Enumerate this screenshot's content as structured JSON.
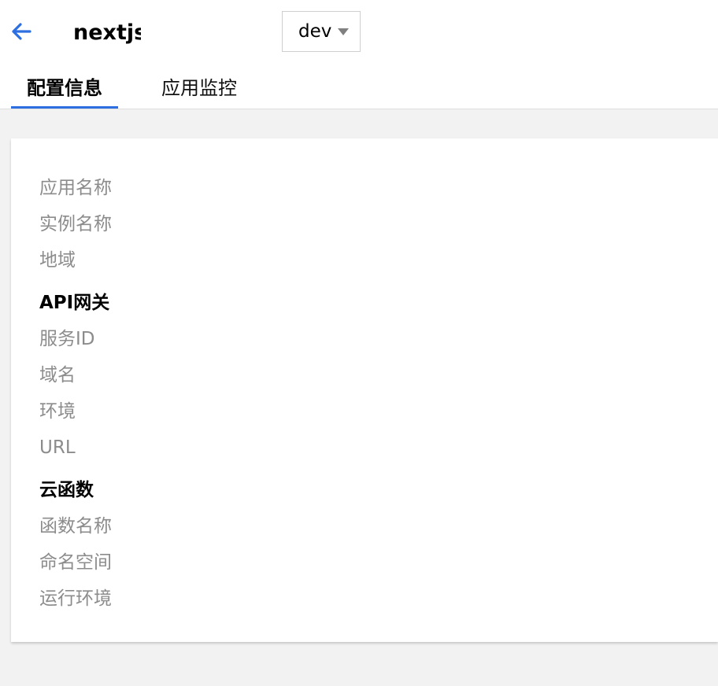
{
  "header": {
    "back_icon": "arrow-left-icon",
    "app_name": "nextjs-",
    "env_select": {
      "value": "dev",
      "icon": "caret-down-icon"
    },
    "accent_color": "#2d6fe0"
  },
  "tabs": [
    {
      "label": "配置信息",
      "active": true
    },
    {
      "label": "应用监控",
      "active": false
    }
  ],
  "config": {
    "app_name_label": "应用名称",
    "instance_name_label": "实例名称",
    "region_label": "地域",
    "api_gateway": {
      "heading": "API网关",
      "service_id_label": "服务ID",
      "domain_label": "域名",
      "environment_label": "环境",
      "url_label": "URL"
    },
    "cloud_function": {
      "heading": "云函数",
      "function_name_label": "函数名称",
      "namespace_label": "命名空间",
      "runtime_label": "运行环境"
    }
  }
}
